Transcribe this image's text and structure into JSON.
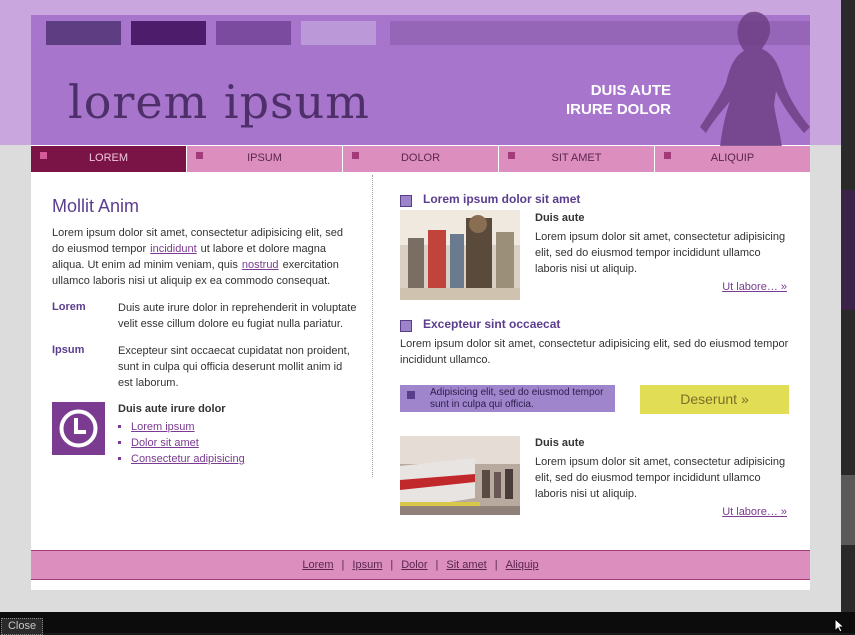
{
  "header": {
    "logo_text": "lorem ipsum",
    "tagline_line1": "DUIS AUTE",
    "tagline_line2": "IRURE DOLOR"
  },
  "nav": {
    "items": [
      {
        "label": "LOREM"
      },
      {
        "label": "IPSUM"
      },
      {
        "label": "DOLOR"
      },
      {
        "label": "SIT AMET"
      },
      {
        "label": "ALIQUIP"
      }
    ]
  },
  "left": {
    "heading": "Mollit Anim",
    "para_part1": "Lorem ipsum dolor sit amet, consectetur adipisicing elit, sed do eiusmod tempor",
    "para_link1": "incididunt",
    "para_part2": "ut labore et dolore magna aliqua. Ut enim ad minim veniam, quis",
    "para_link2": "nostrud",
    "para_part3": "exercitation ullamco laboris nisi ut aliquip ex ea commodo consequat.",
    "defs": [
      {
        "term": "Lorem",
        "text": "Duis aute irure dolor in reprehenderit in voluptate velit esse cillum dolore eu fugiat nulla pariatur."
      },
      {
        "term": "Ipsum",
        "text": "Excepteur sint occaecat cupidatat non proident, sunt in culpa qui officia deserunt mollit anim id est laborum."
      }
    ],
    "list_title": "Duis aute irure dolor",
    "list_items": [
      "Lorem ipsum",
      "Dolor sit amet",
      "Consectetur adipisicing"
    ]
  },
  "right": {
    "section1_title": "Lorem ipsum dolor sit amet",
    "section1_sub": "Duis aute",
    "section1_text": "Lorem ipsum dolor sit amet, consectetur adipisicing elit, sed do eiusmod tempor incididunt ullamco laboris nisi ut aliquip.",
    "section1_more": "Ut labore… »",
    "section2_title": "Excepteur sint occaecat",
    "section2_text": "Lorem ipsum dolor sit amet, consectetur adipisicing elit, sed do eiusmod tempor incididunt ullamco.",
    "note_text": "Adipisicing elit, sed do eiusmod tempor sunt in culpa qui officia.",
    "cta_label": "Deserunt »",
    "section3_sub": "Duis aute",
    "section3_text": "Lorem ipsum dolor sit amet, consectetur adipisicing elit, sed do eiusmod tempor incididunt ullamco laboris nisi ut aliquip.",
    "section3_more": "Ut labore… »"
  },
  "footer": {
    "links": [
      "Lorem",
      "Ipsum",
      "Dolor",
      "Sit amet",
      "Aliquip"
    ],
    "separator": "|"
  },
  "lightbox": {
    "close_label": "Close"
  },
  "colors": {
    "header_purple": "#a775cc",
    "nav_pink": "#dc8fbf",
    "nav_active": "#7b1446",
    "heading_purple": "#5b3d8e",
    "cta_yellow": "#e1dd55"
  }
}
